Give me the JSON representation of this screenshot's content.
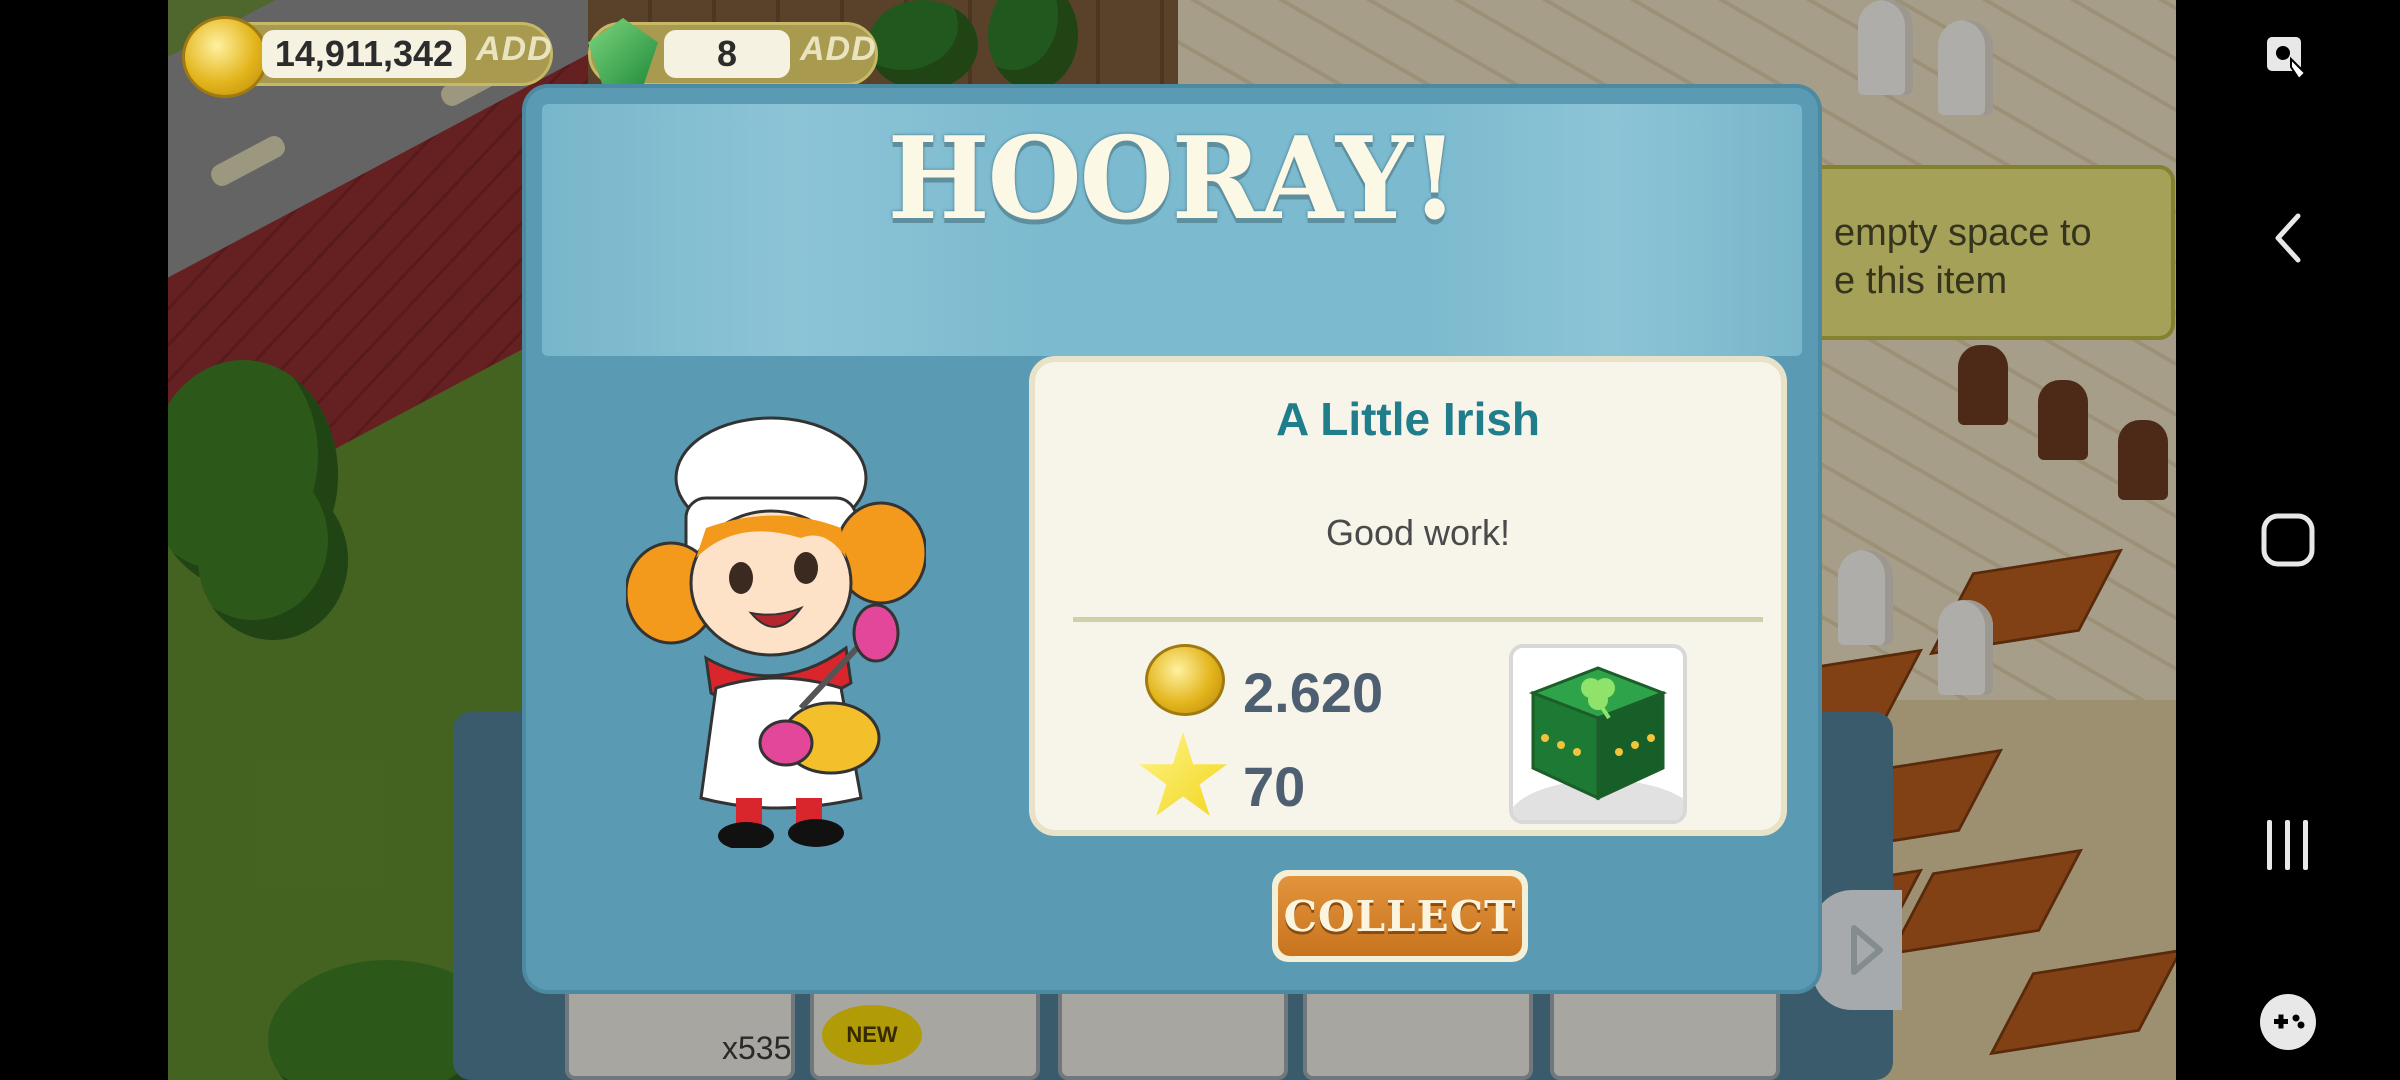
{
  "hud": {
    "coins": "14,911,342",
    "coins_add": "ADD",
    "gems": "8",
    "gems_add": "ADD"
  },
  "hint": {
    "line1": "empty space to",
    "line2": "e this item"
  },
  "shelf": {
    "item_quantity": "x535",
    "new_badge": "NEW"
  },
  "dialog": {
    "title": "HOORAY!",
    "goal_title": "A Little Irish",
    "goal_message": "Good work!",
    "reward_coins": "2.620",
    "reward_xp": "70",
    "collect_label": "COLLECT"
  },
  "navbar": {
    "icons": [
      "screenshot-edit-icon",
      "back-icon",
      "home-icon",
      "recent-apps-icon",
      "game-tools-icon"
    ]
  },
  "colors": {
    "dialog_bg": "#5a9bb3",
    "goal_title": "#1f7d8c",
    "collect_button": "#d5832c",
    "hint_bg": "#e7e07a"
  }
}
